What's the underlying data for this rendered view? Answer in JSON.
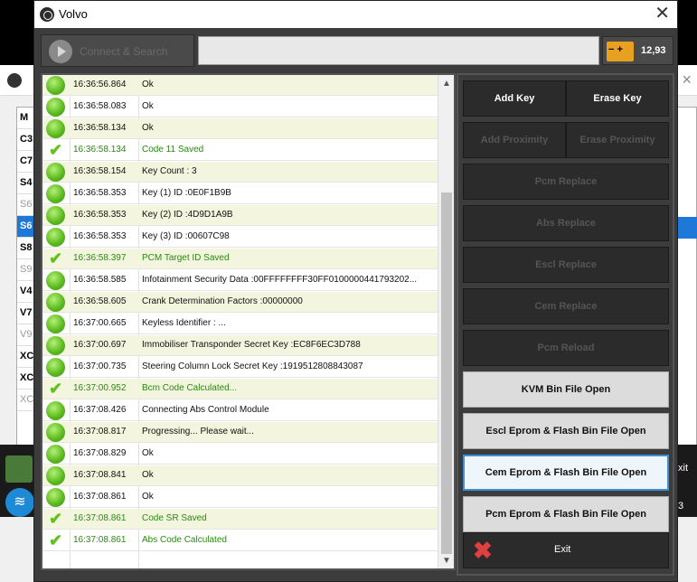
{
  "window": {
    "title": "Volvo"
  },
  "toolbar": {
    "connect_label": "Connect & Search",
    "battery_voltage": "12,93"
  },
  "background_window": {
    "rows": [
      "M",
      "C3",
      "C7",
      "S4",
      "S6",
      "S6",
      "S8",
      "S9",
      "V4",
      "V7",
      "V9",
      "XC",
      "XC",
      "XC"
    ],
    "exit_fragment": "xit",
    "count_fragment": "3"
  },
  "log": [
    {
      "status": "ok",
      "time": "16:36:56.864",
      "message": "Ok"
    },
    {
      "status": "ok",
      "time": "16:36:58.083",
      "message": "Ok"
    },
    {
      "status": "ok",
      "time": "16:36:58.134",
      "message": "Ok"
    },
    {
      "status": "done",
      "time": "16:36:58.134",
      "message": "Code 11 Saved"
    },
    {
      "status": "ok",
      "time": "16:36:58.154",
      "message": "Key Count : 3"
    },
    {
      "status": "ok",
      "time": "16:36:58.353",
      "message": "Key (1) ID :0E0F1B9B"
    },
    {
      "status": "ok",
      "time": "16:36:58.353",
      "message": "Key (2) ID :4D9D1A9B"
    },
    {
      "status": "ok",
      "time": "16:36:58.353",
      "message": "Key (3) ID :00607C98"
    },
    {
      "status": "done",
      "time": "16:36:58.397",
      "message": "PCM Target ID Saved"
    },
    {
      "status": "ok",
      "time": "16:36:58.585",
      "message": "Infotainment Security Data :00FFFFFFFF30FF0100000441793202..."
    },
    {
      "status": "ok",
      "time": "16:36:58.605",
      "message": "Crank Determination Factors :00000000"
    },
    {
      "status": "ok",
      "time": "16:37:00.665",
      "message": "Keyless Identifier : ..."
    },
    {
      "status": "ok",
      "time": "16:37:00.697",
      "message": "Immobiliser Transponder Secret Key :EC8F6EC3D788"
    },
    {
      "status": "ok",
      "time": "16:37:00.735",
      "message": "Steering Column Lock Secret Key :1919512808843087"
    },
    {
      "status": "done",
      "time": "16:37:00.952",
      "message": "Bcm Code Calculated..."
    },
    {
      "status": "ok",
      "time": "16:37:08.426",
      "message": "Connecting Abs Control Module"
    },
    {
      "status": "ok",
      "time": "16:37:08.817",
      "message": "Progressing... Please wait..."
    },
    {
      "status": "ok",
      "time": "16:37:08.829",
      "message": "Ok"
    },
    {
      "status": "ok",
      "time": "16:37:08.841",
      "message": "Ok"
    },
    {
      "status": "ok",
      "time": "16:37:08.861",
      "message": "Ok"
    },
    {
      "status": "done",
      "time": "16:37:08.861",
      "message": "Code SR Saved"
    },
    {
      "status": "done",
      "time": "16:37:08.861",
      "message": "Abs Code Calculated"
    }
  ],
  "buttons": {
    "add_key": "Add Key",
    "erase_key": "Erase Key",
    "add_proximity": "Add Proximity",
    "erase_proximity": "Erase Proximity",
    "pcm_replace": "Pcm Replace",
    "abs_replace": "Abs Replace",
    "escl_replace": "Escl Replace",
    "cem_replace": "Cem Replace",
    "pcm_reload": "Pcm Reload",
    "kvm_bin": "KVM Bin File Open",
    "escl_eprom": "Escl Eprom & Flash Bin File Open",
    "cem_eprom": "Cem Eprom & Flash Bin File Open",
    "pcm_eprom": "Pcm Eprom & Flash Bin File Open",
    "exit": "Exit"
  },
  "colors": {
    "ok_green": "#5dbd1f",
    "saved_text": "#2a8a10",
    "focus_border": "#3c8fd6",
    "battery": "#e8a020"
  }
}
